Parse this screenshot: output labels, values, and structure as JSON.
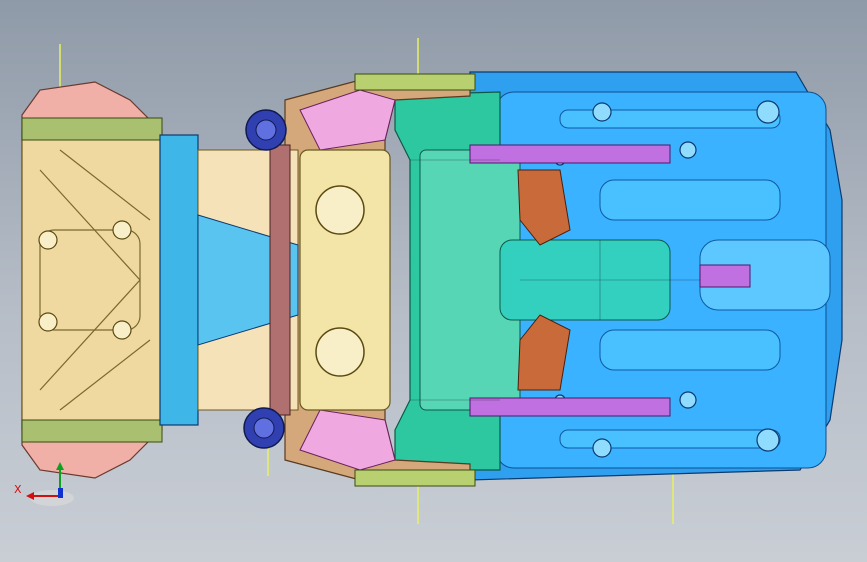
{
  "viewport": {
    "background_top": "#8f9aa8",
    "background_bottom": "#c9ced5"
  },
  "triad": {
    "x_label": "X",
    "x_color": "#d01010",
    "y_color": "#10a020",
    "z_color": "#1030d0"
  },
  "parts": {
    "front_rail_color": "#f0d9a0",
    "crossmember_color": "#3fb6e8",
    "tunnel_color": "#2ec8a0",
    "rear_floor_color": "#2fa0f0",
    "bracket_color": "#c070e0",
    "strut_mount_color": "#3040b0"
  }
}
